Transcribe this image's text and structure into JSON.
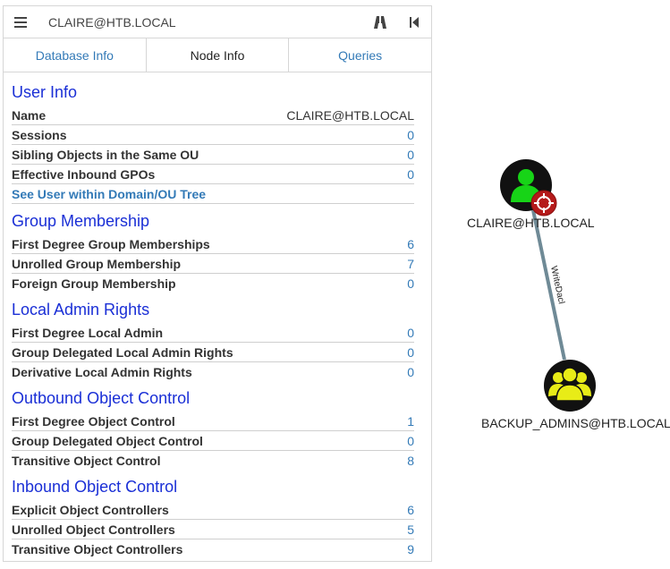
{
  "search": {
    "value": "CLAIRE@HTB.LOCAL"
  },
  "tabs": [
    {
      "label": "Database Info"
    },
    {
      "label": "Node Info"
    },
    {
      "label": "Queries"
    }
  ],
  "sections": {
    "user_info": {
      "title": "User Info",
      "rows": [
        {
          "label": "Name",
          "value": "CLAIRE@HTB.LOCAL"
        },
        {
          "label": "Sessions",
          "value": "0"
        },
        {
          "label": "Sibling Objects in the Same OU",
          "value": "0"
        },
        {
          "label": "Effective Inbound GPOs",
          "value": "0"
        },
        {
          "label": "See User within Domain/OU Tree",
          "value": ""
        }
      ]
    },
    "group_membership": {
      "title": "Group Membership",
      "rows": [
        {
          "label": "First Degree Group Memberships",
          "value": "6"
        },
        {
          "label": "Unrolled Group Membership",
          "value": "7"
        },
        {
          "label": "Foreign Group Membership",
          "value": "0"
        }
      ]
    },
    "local_admin": {
      "title": "Local Admin Rights",
      "rows": [
        {
          "label": "First Degree Local Admin",
          "value": "0"
        },
        {
          "label": "Group Delegated Local Admin Rights",
          "value": "0"
        },
        {
          "label": "Derivative Local Admin Rights",
          "value": "0"
        }
      ]
    },
    "outbound": {
      "title": "Outbound Object Control",
      "rows": [
        {
          "label": "First Degree Object Control",
          "value": "1"
        },
        {
          "label": "Group Delegated Object Control",
          "value": "0"
        },
        {
          "label": "Transitive Object Control",
          "value": "8"
        }
      ]
    },
    "inbound": {
      "title": "Inbound Object Control",
      "rows": [
        {
          "label": "Explicit Object Controllers",
          "value": "6"
        },
        {
          "label": "Unrolled Object Controllers",
          "value": "5"
        },
        {
          "label": "Transitive Object Controllers",
          "value": "9"
        }
      ]
    }
  },
  "graph": {
    "source_node": {
      "label": "CLAIRE@HTB.LOCAL",
      "icon": "user-icon",
      "badge_icon": "target-icon"
    },
    "target_node": {
      "label": "BACKUP_ADMINS@HTB.LOCAL",
      "icon": "group-icon"
    },
    "edge": {
      "label": "WriteDacl"
    }
  },
  "colors": {
    "section_title": "#1a2fd6",
    "link": "#337ab7",
    "user_node": "#17d417",
    "group_node": "#e8ec17",
    "badge": "#b51a1a",
    "edge": "#6f8a96"
  }
}
